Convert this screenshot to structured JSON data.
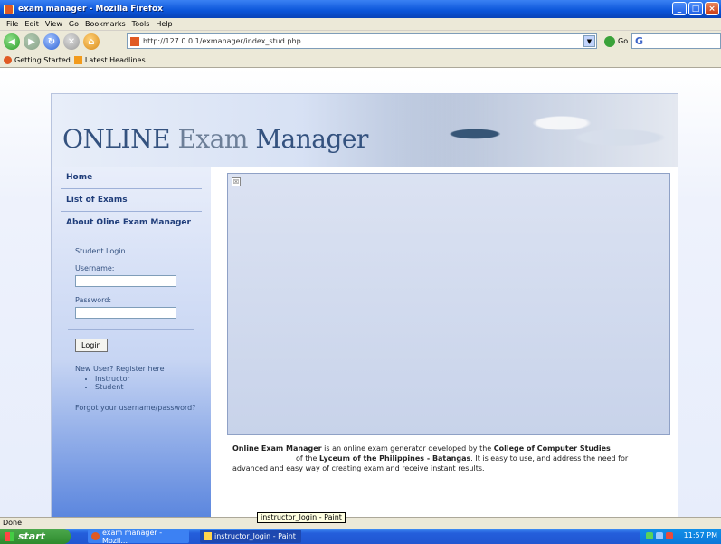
{
  "window": {
    "title": "exam manager - Mozilla Firefox",
    "controls": [
      "_",
      "□",
      "×"
    ]
  },
  "menu": [
    "File",
    "Edit",
    "View",
    "Go",
    "Bookmarks",
    "Tools",
    "Help"
  ],
  "address_bar": {
    "url": "http://127.0.0.1/exmanager/index_stud.php"
  },
  "go_label": "Go",
  "bookmarks": [
    {
      "label": "Getting Started",
      "icon": "firefox-icon"
    },
    {
      "label": "Latest Headlines",
      "icon": "rss-icon"
    }
  ],
  "banner": {
    "title_part1": "ONLINE",
    "title_part2": "Exam",
    "title_part3": "Manager"
  },
  "sidebar": {
    "nav": [
      "Home",
      "List of Exams",
      "About Oline Exam Manager"
    ],
    "login_title": "Student Login",
    "username_label": "Username:",
    "password_label": "Password:",
    "login_button": "Login",
    "register_text": "New User? Register here",
    "register_links": [
      "Instructor",
      "Student"
    ],
    "forgot_text": "Forgot your username/password?"
  },
  "content": {
    "broken_image": "☒"
  },
  "about": {
    "p1_bold1": "Online Exam Manager",
    "p1_text1": " is an online exam generator developed by the ",
    "p1_bold2": "College of Computer Studies",
    "p2_text1": "of the ",
    "p2_bold": "Lyceum of the Philippines - Batangas",
    "p2_text2": ". It is easy to use, and address the need for",
    "p3_text": "advanced and easy way of creating exam and receive instant results."
  },
  "status": {
    "text": "Done",
    "tooltip": "instructor_login - Paint"
  },
  "taskbar": {
    "start": "start",
    "tasks": [
      "exam manager - Mozil...",
      "instructor_login - Paint"
    ],
    "clock": "11:57 PM"
  },
  "colors": {
    "titlebar": "#0a54d9",
    "sidebar_bottom": "#5b86de",
    "nav_text": "#1f3d7a",
    "logo_text": "#34527f"
  }
}
